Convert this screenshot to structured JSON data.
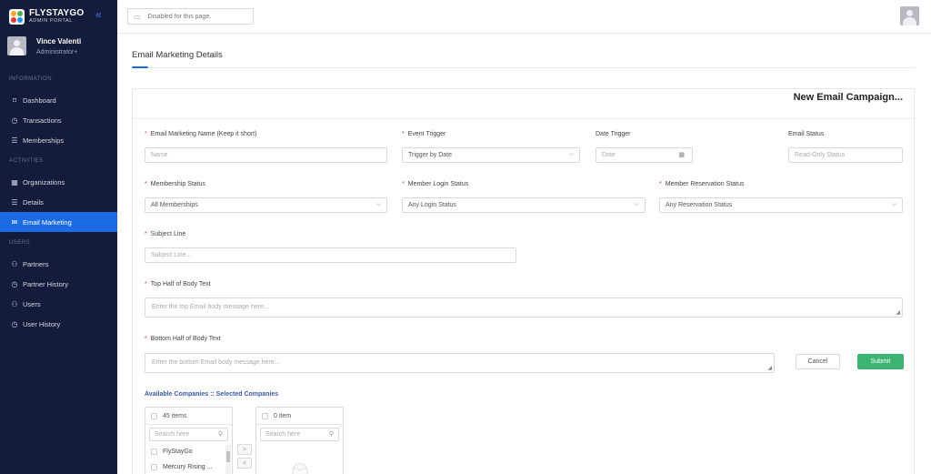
{
  "brand": {
    "title": "FLYSTAYGO",
    "subtitle": "ADMIN PORTAL"
  },
  "user": {
    "name": "Vince Valenti",
    "role": "Administrator+"
  },
  "sidebar": {
    "sections": [
      "INFORMATION",
      "ACTIVITIES",
      "USERS"
    ],
    "items": [
      {
        "label": "Dashboard",
        "icon": "bookmark-icon"
      },
      {
        "label": "Transactions",
        "icon": "clock-icon"
      },
      {
        "label": "Memberships",
        "icon": "list-icon"
      },
      {
        "label": "Organizations",
        "icon": "building-icon"
      },
      {
        "label": "Details",
        "icon": "list-icon"
      },
      {
        "label": "Email Marketing",
        "icon": "mail-icon",
        "active": true
      },
      {
        "label": "Partners",
        "icon": "person-icon"
      },
      {
        "label": "Partner History",
        "icon": "clock-icon"
      },
      {
        "label": "Users",
        "icon": "person-icon"
      },
      {
        "label": "User History",
        "icon": "clock-icon"
      }
    ]
  },
  "topbar": {
    "search_placeholder": "Disabled for this page."
  },
  "page": {
    "title": "Email Marketing Details"
  },
  "card": {
    "title": "New Email Campaign..."
  },
  "form": {
    "name": {
      "label": "Email Marketing Name (Keep it short)",
      "placeholder": "Name"
    },
    "event_trigger": {
      "label": "Event Trigger",
      "value": "Trigger by Date"
    },
    "date_trigger": {
      "label": "Date Trigger",
      "placeholder": "Date"
    },
    "email_status": {
      "label": "Email Status",
      "placeholder": "Read-Only Status"
    },
    "membership_status": {
      "label": "Membership Status",
      "value": "All Memberships"
    },
    "login_status": {
      "label": "Member Login Status",
      "value": "Any Login Status"
    },
    "reservation_status": {
      "label": "Member Reservation Status",
      "value": "Any Reservation Status"
    },
    "subject": {
      "label": "Subject Line",
      "placeholder": "Subject Line..."
    },
    "top_body": {
      "label": "Top Half of Body Text",
      "placeholder": "Enter the top Email body message here..."
    },
    "bottom_body": {
      "label": "Bottom Half of Body Text",
      "placeholder": "Enter the bottom Email body message here..."
    },
    "cancel_label": "Cancel",
    "submit_label": "Submit"
  },
  "transfer": {
    "title": "Available Companies :: Selected Companies",
    "left": {
      "count": "45 items",
      "search_placeholder": "Search here",
      "items": [
        "FlyStayGo",
        "Mercury Rising ..."
      ]
    },
    "right": {
      "count": "0 item",
      "search_placeholder": "Search here"
    },
    "move_right": ">",
    "move_left": "<"
  },
  "colors": {
    "sidebar_bg": "#151b3a",
    "accent": "#1d6ae5",
    "submit": "#3cb371",
    "required": "#e53935"
  }
}
